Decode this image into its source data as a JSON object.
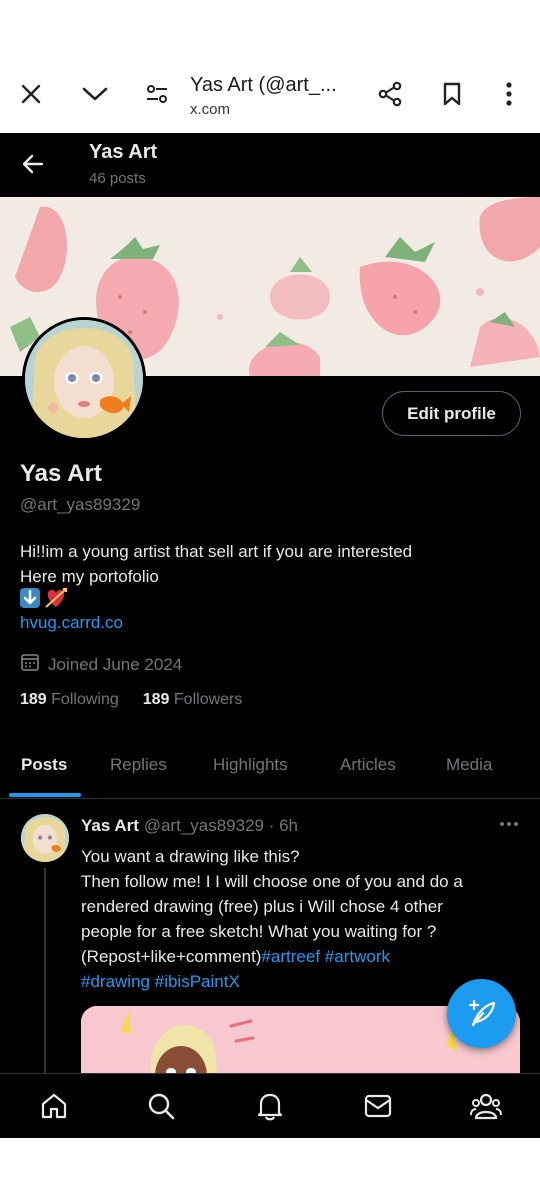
{
  "browser": {
    "title": "Yas Art (@art_...",
    "url": "x.com"
  },
  "header": {
    "name": "Yas Art",
    "post_count": "46 posts"
  },
  "profile": {
    "edit_button": "Edit profile",
    "display_name": "Yas Art",
    "handle": "@art_yas89329",
    "bio_line1": "Hi!!im a young artist that sell art if you are interested",
    "bio_line2": "Here my portofolio",
    "emoji_down": "⬇️",
    "emoji_heart": "💘",
    "link": "hvug.carrd.co",
    "joined": "Joined June 2024",
    "following_count": "189",
    "following_label": "Following",
    "followers_count": "189",
    "followers_label": "Followers"
  },
  "tabs": [
    {
      "label": "Posts"
    },
    {
      "label": "Replies"
    },
    {
      "label": "Highlights"
    },
    {
      "label": "Articles"
    },
    {
      "label": "Media"
    }
  ],
  "post": {
    "author": "Yas Art",
    "handle": "@art_yas89329",
    "time": "· 6h",
    "line1": "You want a drawing like this?",
    "line2": "Then follow me! I I will choose one of you and  do a",
    "line3": "rendered drawing (free)   plus i Will chose 4 other",
    "line4": "people  for a free sketch! What you waiting for ?",
    "line5": "(Repost+like+comment)",
    "tag1": "#artreef",
    "tag2": "#artwork",
    "tag3": "#drawing",
    "tag4": "#ibisPaintX"
  },
  "colors": {
    "accent": "#1d9bf0",
    "background": "#000000",
    "text_primary": "#e7e9ea",
    "text_secondary": "#71767b"
  },
  "icons": {
    "browser": [
      "close-icon",
      "chevron-down-icon",
      "site-settings-icon",
      "share-icon",
      "bookmark-icon",
      "more-vertical-icon"
    ],
    "nav": [
      "home-icon",
      "search-icon",
      "notifications-icon",
      "messages-icon",
      "communities-icon"
    ]
  }
}
